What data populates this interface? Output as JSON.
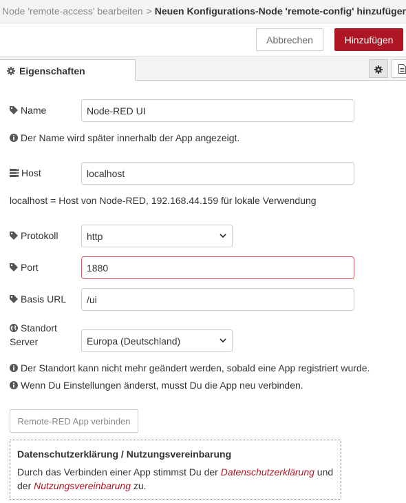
{
  "breadcrumb": {
    "previous": "Node 'remote-access' bearbeiten",
    "separator": ">",
    "current": "Neuen Konfigurations-Node 'remote-config' hinzufügen"
  },
  "buttons": {
    "cancel": "Abbrechen",
    "add": "Hinzufügen"
  },
  "tabs": {
    "properties": "Eigenschaften"
  },
  "form": {
    "name": {
      "label": "Name",
      "value": "Node-RED UI",
      "hint": "Der Name wird später innerhalb der App angezeigt."
    },
    "host": {
      "label": "Host",
      "value": "localhost",
      "hint": "localhost = Host von Node-RED, 192.168.44.159 für lokale Verwendung"
    },
    "protocol": {
      "label": "Protokoll",
      "value": "http"
    },
    "port": {
      "label": "Port",
      "value": "1880"
    },
    "base_url": {
      "label": "Basis URL",
      "value": "/ui"
    },
    "server": {
      "label_line1": "Standort",
      "label_line2": "Server",
      "value": "Europa (Deutschland)"
    }
  },
  "notes": [
    "Der Standort kann nicht mehr geändert werden, sobald eine App registriert wurde.",
    "Wenn Du Einstellungen änderst, musst Du die App neu verbinden."
  ],
  "connect_button": "Remote-RED App verbinden",
  "privacy": {
    "title": "Datenschutzerklärung / Nutzungsvereinbarung",
    "text_before": "Durch das Verbinden einer App stimmst Du der ",
    "link1": "Datenschutzerklärung",
    "text_middle": " und der ",
    "link2": "Nutzungsvereinbarung",
    "text_after": " zu."
  },
  "colors": {
    "accent": "#ad1625",
    "error_border": "#d6615f"
  },
  "icons": [
    "cog-icon",
    "tag-icon",
    "server-icon",
    "globe-icon",
    "info-icon",
    "chevron-down-icon",
    "document-icon"
  ]
}
